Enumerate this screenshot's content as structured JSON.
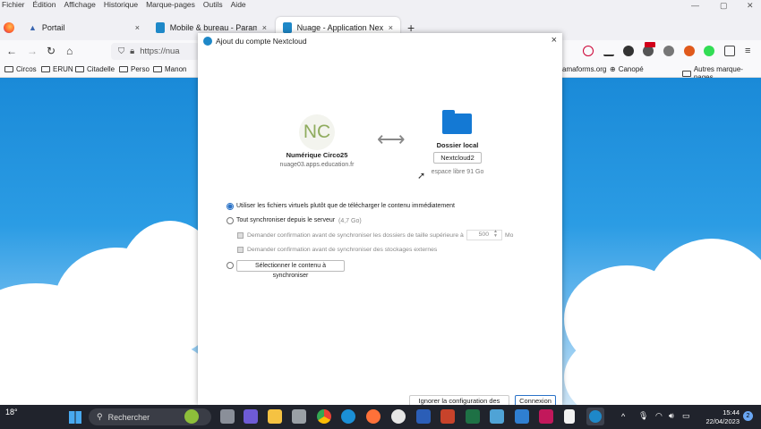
{
  "menubar": [
    "Fichier",
    "Édition",
    "Affichage",
    "Historique",
    "Marque-pages",
    "Outils",
    "Aide"
  ],
  "tabs": [
    {
      "label": "Portail",
      "color": "#3a66b0"
    },
    {
      "label": "Mobile & bureau - Paramètres",
      "color": "#1e88c8"
    },
    {
      "label": "Nuage - Application Nextcloud",
      "color": "#1e88c8"
    }
  ],
  "new_tab": "+",
  "close_symbol": "×",
  "url": "https://nua",
  "bookmarks": {
    "left": [
      "Circos",
      "ERUN",
      "Citadelle",
      "Perso",
      "Manon"
    ],
    "partial": "amaforms.org",
    "canope": "Canopé",
    "other": "Autres marque-pages"
  },
  "dialog": {
    "title": "Ajout du compte Nextcloud",
    "account_initials": "NC",
    "account_name": "Numérique Circo25",
    "server": "nuage03.apps.education.fr",
    "arrow": "⟷",
    "local_title": "Dossier local",
    "folder_name": "Nextcloud2",
    "free_space": "espace libre 91 Go",
    "option_virtual": "Utiliser les fichiers virtuels plutôt que de télécharger le contenu immédiatement",
    "option_sync_all": "Tout synchroniser depuis le serveur",
    "sync_size": "(4,7 Go)",
    "confirm_large": "Demander confirmation avant de synchroniser les dossiers de taille supérieure à",
    "size_limit": "500",
    "unit": "Mo",
    "confirm_external": "Demander confirmation avant de synchroniser des stockages externes",
    "choose_button": "Sélectionner le contenu à synchroniser",
    "ignore_button": "Ignorer la configuration des dossiers",
    "connect_button": "Connexion"
  },
  "taskbar": {
    "weather": "18°",
    "search": "Rechercher",
    "time": "15:44",
    "date": "22/04/2023",
    "notifications": "2"
  },
  "colors": {
    "accent": "#2b73c7",
    "folder": "#1479d4",
    "taskbar": "#20232c"
  }
}
